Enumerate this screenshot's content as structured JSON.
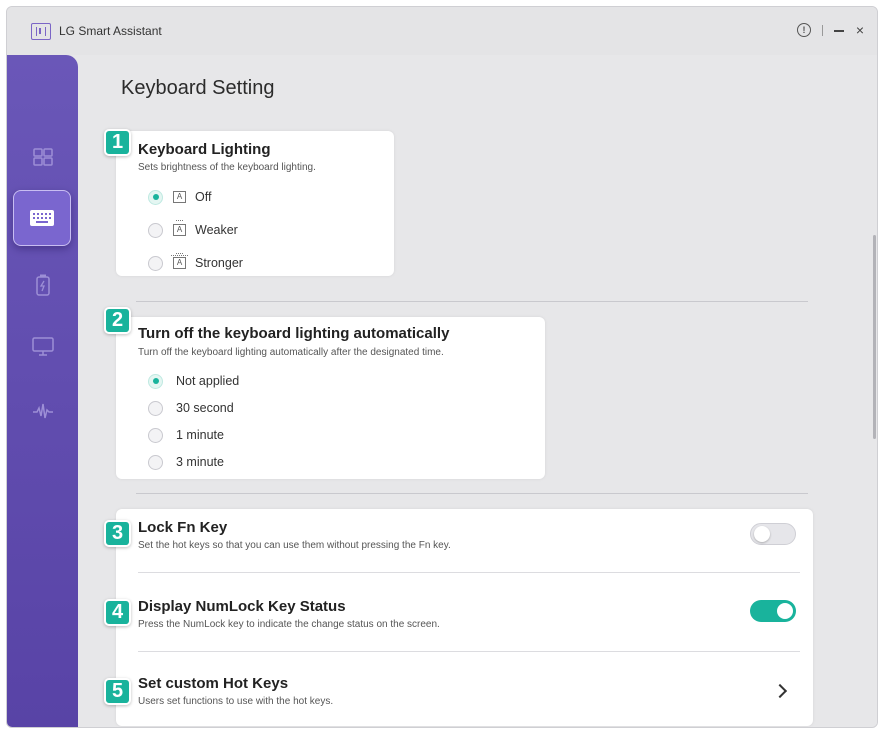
{
  "window": {
    "app_title": "LG Smart Assistant",
    "controls": {
      "info_icon": "info-circle-icon",
      "minimize_icon": "minimize-icon",
      "close_icon": "close-icon"
    }
  },
  "sidebar": {
    "items": [
      {
        "name": "dashboard",
        "icon": "dashboard-grid-icon",
        "active": false
      },
      {
        "name": "keyboard",
        "icon": "keyboard-icon",
        "active": true
      },
      {
        "name": "battery",
        "icon": "battery-icon",
        "active": false
      },
      {
        "name": "display",
        "icon": "monitor-icon",
        "active": false
      },
      {
        "name": "audio",
        "icon": "audio-wave-icon",
        "active": false
      }
    ]
  },
  "page_title": "Keyboard Setting",
  "accent_color": "#19b39c",
  "sections": {
    "keyboard_lighting": {
      "badge": "1",
      "title": "Keyboard Lighting",
      "description": "Sets brightness of the keyboard lighting.",
      "options": [
        {
          "label": "Off",
          "icon_text": "A",
          "selected": true
        },
        {
          "label": "Weaker",
          "icon_text": "A",
          "selected": false
        },
        {
          "label": "Stronger",
          "icon_text": "A",
          "selected": false
        }
      ]
    },
    "auto_off": {
      "badge": "2",
      "title": "Turn off the keyboard lighting automatically",
      "description": "Turn off the keyboard lighting automatically after the designated time.",
      "options": [
        {
          "label": "Not applied",
          "selected": true
        },
        {
          "label": "30 second",
          "selected": false
        },
        {
          "label": "1 minute",
          "selected": false
        },
        {
          "label": "3 minute",
          "selected": false
        }
      ]
    },
    "lock_fn": {
      "badge": "3",
      "title": "Lock Fn Key",
      "description": "Set the hot keys so that you can use them without pressing the Fn key.",
      "enabled": false
    },
    "numlock": {
      "badge": "4",
      "title": "Display NumLock Key Status",
      "description": "Press the NumLock key to indicate the change status on the screen.",
      "enabled": true
    },
    "hot_keys": {
      "badge": "5",
      "title": "Set custom Hot Keys",
      "description": "Users set functions to use with the hot keys."
    }
  }
}
